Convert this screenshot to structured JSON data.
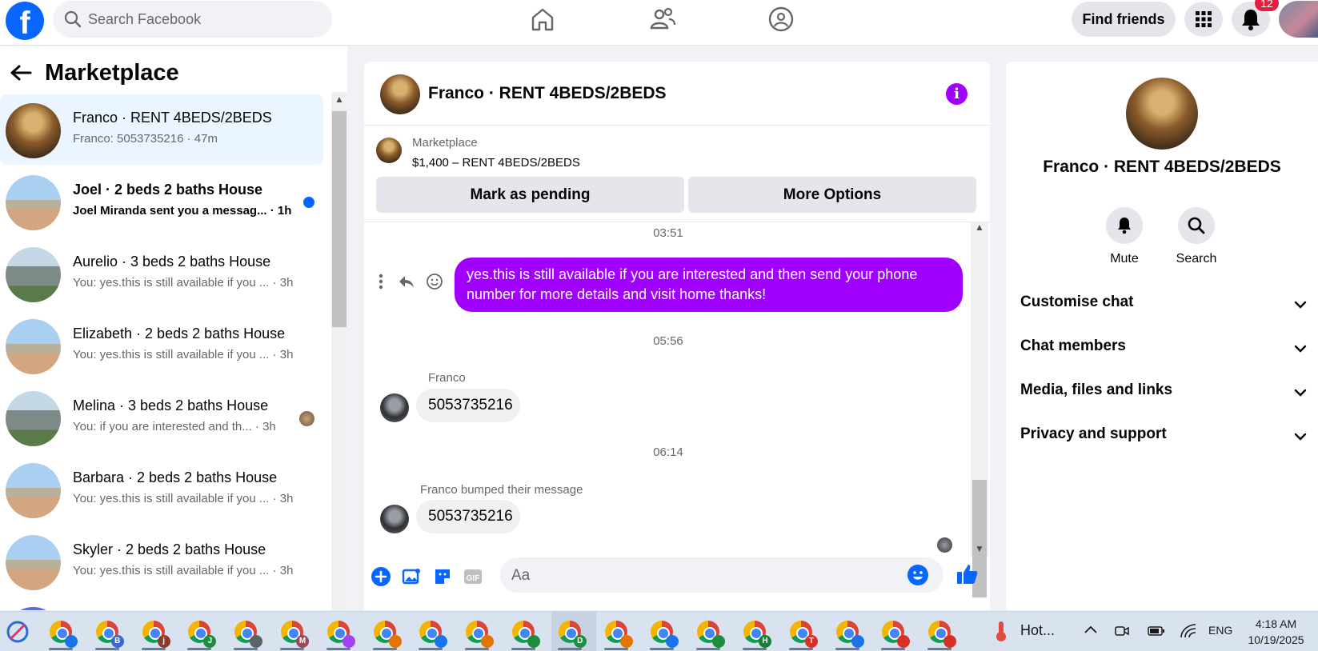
{
  "topbar": {
    "search_placeholder": "Search Facebook",
    "find_friends": "Find friends",
    "notification_count": "12"
  },
  "marketplace": {
    "title": "Marketplace",
    "conversations": [
      {
        "name": "Franco · RENT 4BEDS/2BEDS",
        "preview": "Franco: 5053735216 · 47m",
        "active": true
      },
      {
        "name": "Joel · 2 beds 2 baths House",
        "preview": "Joel Miranda sent you a messag... · 1h",
        "unread": true
      },
      {
        "name": "Aurelio · 3 beds 2 baths House",
        "preview": "You: yes.this is still available if you ... · 3h"
      },
      {
        "name": "Elizabeth · 2 beds 2 baths House",
        "preview": "You: yes.this is still available if you ... · 3h"
      },
      {
        "name": "Melina · 3 beds 2 baths House",
        "preview": "You: if you are interested and th... · 3h"
      },
      {
        "name": "Barbara · 2 beds 2 baths House",
        "preview": "You: yes.this is still available if you ... · 3h"
      },
      {
        "name": "Skyler · 2 beds 2 baths House",
        "preview": "You: yes.this is still available if you ... · 3h"
      }
    ]
  },
  "chat": {
    "title": "Franco · RENT 4BEDS/2BEDS",
    "listing_category": "Marketplace",
    "listing_price": "$1,400 – RENT 4BEDS/2BEDS",
    "mark_pending": "Mark as pending",
    "more_options": "More Options",
    "messages": {
      "time1": "03:51",
      "outgoing": "yes.this is still available if you are interested and  then send your phone number for more details and visit home thanks!",
      "time2": "05:56",
      "sender1": "Franco",
      "incoming1": "5053735216",
      "time3": "06:14",
      "sender2": "Franco bumped their message",
      "incoming2": "5053735216"
    },
    "composer_placeholder": "Aa",
    "gif_label": "GIF"
  },
  "details": {
    "name": "Franco · RENT 4BEDS/2BEDS",
    "mute": "Mute",
    "search": "Search",
    "sections": [
      "Customise chat",
      "Chat members",
      "Media, files and links",
      "Privacy and support"
    ]
  },
  "taskbar": {
    "weather": "Hot...",
    "language": "ENG",
    "time": "4:18 AM",
    "date": "10/19/2025",
    "app_letters": [
      "",
      "B",
      "j",
      "J",
      "",
      "M",
      "",
      "",
      "",
      "",
      "",
      "D",
      "",
      "",
      "",
      "H",
      "T",
      "",
      "",
      ""
    ]
  },
  "colors": {
    "brand": "#0866ff",
    "message_purple": "#a100ff",
    "unread_dot": "#0866ff"
  }
}
